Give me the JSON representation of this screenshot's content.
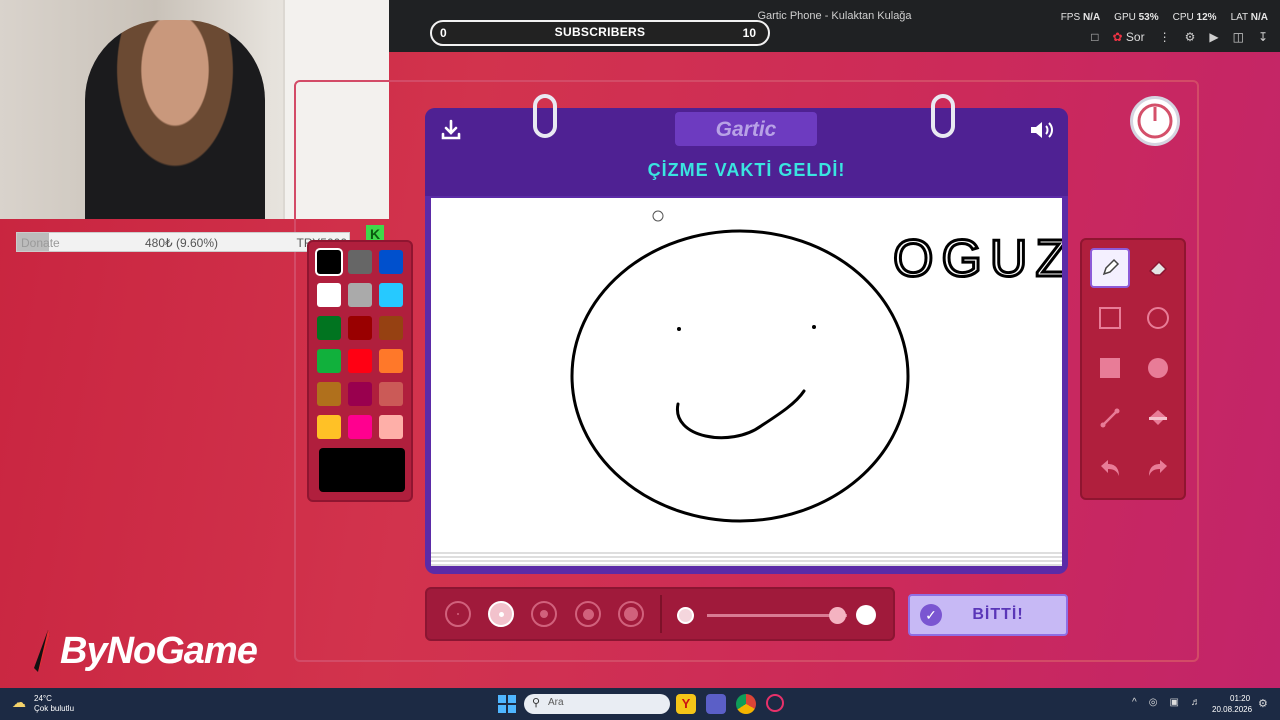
{
  "browser": {
    "tab_title": "Gartic Phone - Kulaktan Kulağa",
    "subscriber_bar": {
      "left": "0",
      "title": "SUBSCRIBERS",
      "right": "10"
    },
    "stats": [
      {
        "label": "FPS",
        "value": "N/A"
      },
      {
        "label": "GPU",
        "value": "53%"
      },
      {
        "label": "CPU",
        "value": "12%"
      },
      {
        "label": "LAT",
        "value": "N/A"
      }
    ],
    "sor_label": "Sor"
  },
  "donate": {
    "label": "Donate",
    "value": "480₺ (9.60%)",
    "goal": "TRY5000",
    "progress_fraction": 0.096,
    "badge": "K"
  },
  "game": {
    "logo": "Gartic",
    "instruction": "ÇİZME VAKTİ GELDİ!",
    "canvas_text": "OGUZ",
    "done_label": "BİTTİ!"
  },
  "palette": {
    "colors": [
      "#000000",
      "#666666",
      "#0050cd",
      "#ffffff",
      "#aaaaaa",
      "#26c9ff",
      "#017420",
      "#990000",
      "#964112",
      "#11b03c",
      "#ff0013",
      "#ff7829",
      "#b0701c",
      "#99004e",
      "#cb5a57",
      "#ffc126",
      "#ff008f",
      "#feafa8"
    ],
    "selected": "#000000"
  },
  "tools": [
    "pencil-icon",
    "eraser-icon",
    "rectangle-outline-icon",
    "circle-outline-icon",
    "rectangle-filled-icon",
    "circle-filled-icon",
    "line-icon",
    "bucket-fill-icon",
    "undo-icon",
    "redo-icon"
  ],
  "brand": {
    "name": "ByNoGame"
  },
  "taskbar": {
    "temperature": "24°C",
    "weather": "Çok bulutlu",
    "search_placeholder": "Ara",
    "time": "01:20",
    "date": "20.08.2026"
  }
}
